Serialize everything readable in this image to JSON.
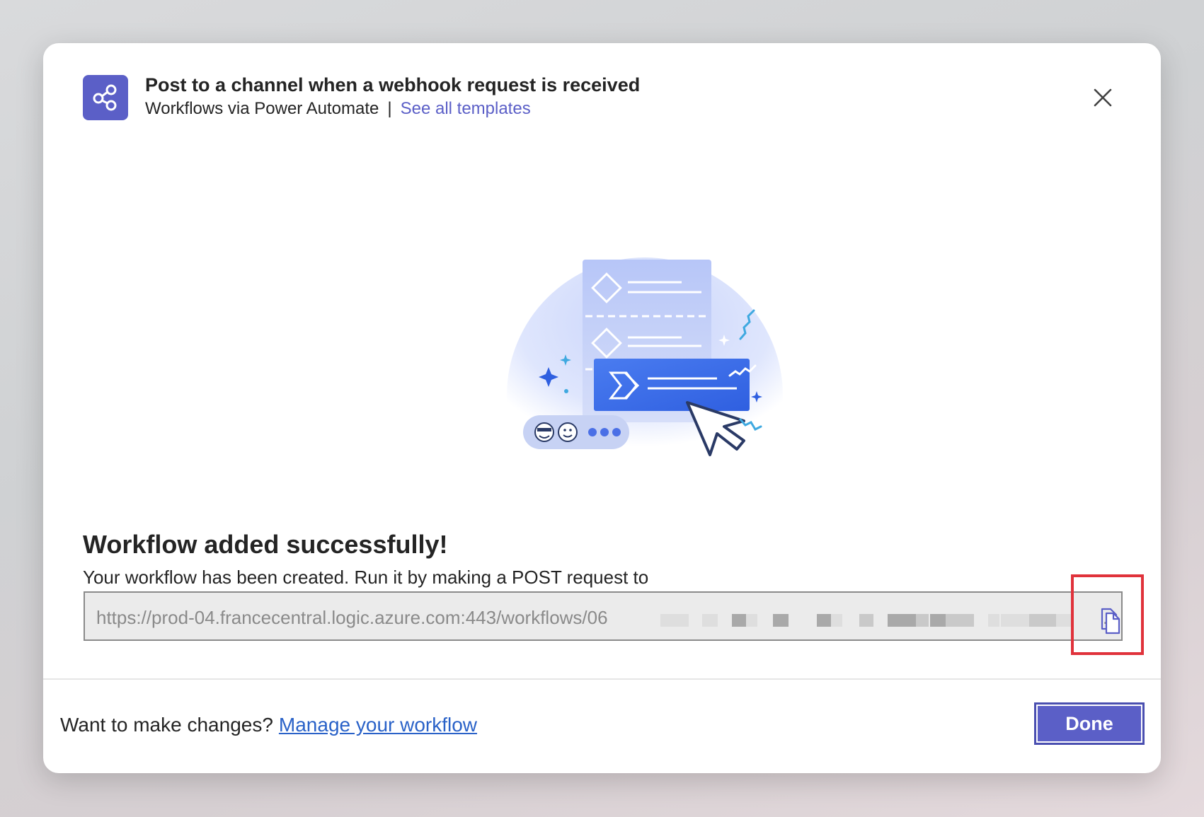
{
  "header": {
    "title": "Post to a channel when a webhook request is received",
    "source": "Workflows via Power Automate",
    "separator": "|",
    "templates_link": "See all templates",
    "app_icon": "share-icon",
    "close_icon": "close-icon"
  },
  "body": {
    "heading": "Workflow added successfully!",
    "description": "Your workflow has been created. Run it by making a POST request to",
    "url_value": "https://prod-04.francecentral.logic.azure.com:443/workflows/06",
    "url_ellipsis": "..",
    "copy_icon": "copy-icon"
  },
  "footer": {
    "prompt": "Want to make changes?",
    "manage_link": "Manage your workflow",
    "done_label": "Done"
  },
  "colors": {
    "brand": "#5b5fc7",
    "link": "#2a62c8",
    "highlight": "#e0323b"
  }
}
